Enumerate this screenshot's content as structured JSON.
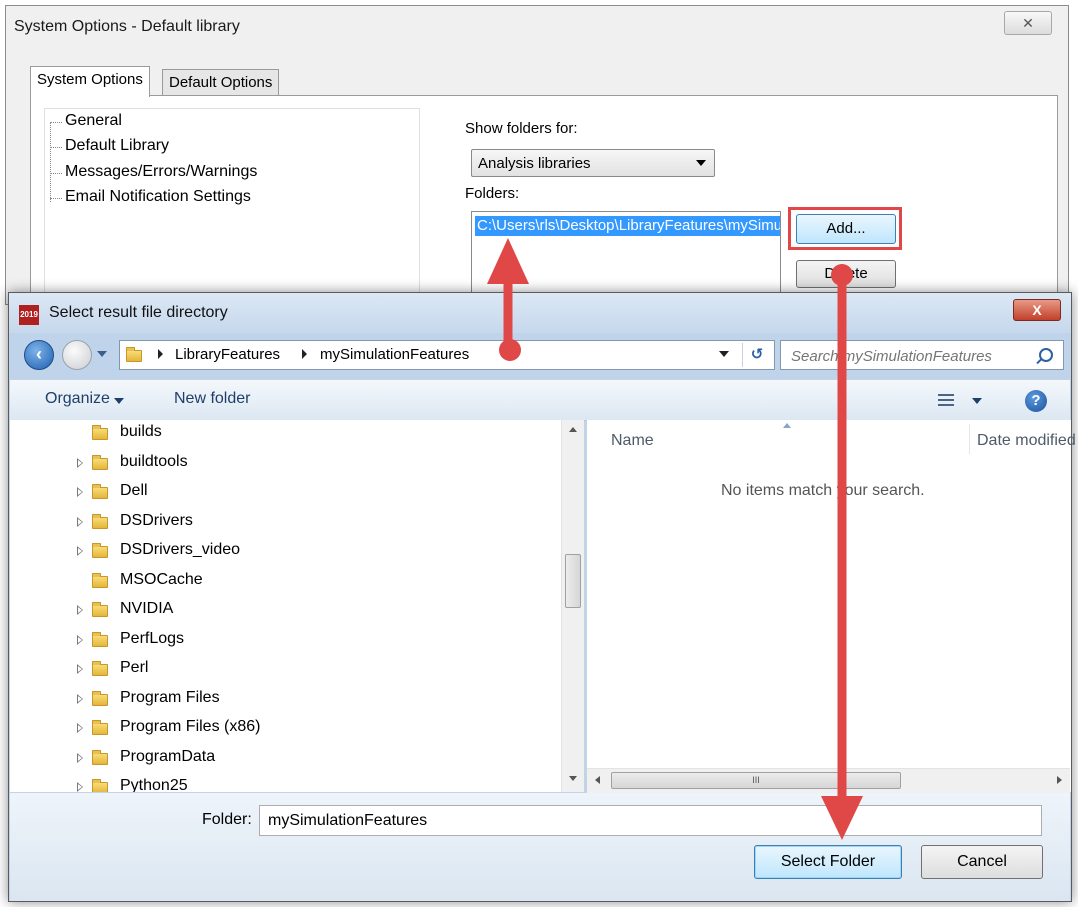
{
  "system_options": {
    "title": "System Options - Default library",
    "close_glyph": "✕",
    "tabs": [
      "System Options",
      "Default Options"
    ],
    "tree": [
      "General",
      "Default Library",
      "Messages/Errors/Warnings",
      "Email Notification Settings"
    ],
    "show_folders_label": "Show folders for:",
    "show_folders_value": "Analysis libraries",
    "folders_label": "Folders:",
    "folder_path": "C:\\Users\\rls\\Desktop\\LibraryFeatures\\mySimulationFeatures",
    "add_button": "Add...",
    "delete_button": "Delete"
  },
  "dialog": {
    "title": "Select result file directory",
    "app_icon_text": "2019",
    "breadcrumb": [
      "LibraryFeatures",
      "mySimulationFeatures"
    ],
    "search_placeholder": "Search mySimulationFeatures",
    "organize": "Organize",
    "new_folder": "New folder",
    "nav_items": [
      {
        "name": "builds",
        "expandable": false
      },
      {
        "name": "buildtools",
        "expandable": true
      },
      {
        "name": "Dell",
        "expandable": true
      },
      {
        "name": "DSDrivers",
        "expandable": true
      },
      {
        "name": "DSDrivers_video",
        "expandable": true
      },
      {
        "name": "MSOCache",
        "expandable": false
      },
      {
        "name": "NVIDIA",
        "expandable": true
      },
      {
        "name": "PerfLogs",
        "expandable": true
      },
      {
        "name": "Perl",
        "expandable": true
      },
      {
        "name": "Program Files",
        "expandable": true
      },
      {
        "name": "Program Files (x86)",
        "expandable": true
      },
      {
        "name": "ProgramData",
        "expandable": true
      },
      {
        "name": "Python25",
        "expandable": true
      }
    ],
    "columns": [
      "Name",
      "Date modified"
    ],
    "empty_message": "No items match your search.",
    "hscroll_grip": "III",
    "folder_label": "Folder:",
    "folder_value": "mySimulationFeatures",
    "select_button": "Select Folder",
    "cancel_button": "Cancel"
  },
  "colors": {
    "highlight": "#3399ff",
    "annotation": "#e04848"
  }
}
